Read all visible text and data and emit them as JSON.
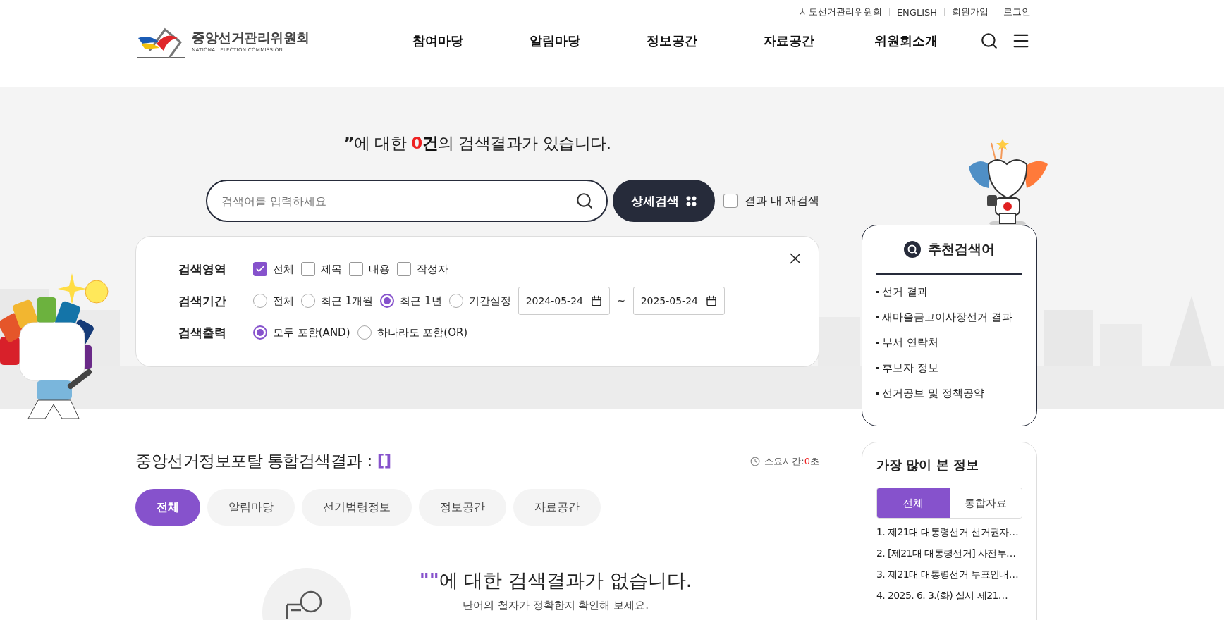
{
  "header": {
    "util_links": [
      "시도선거관리위원회",
      "ENGLISH",
      "회원가입",
      "로그인"
    ],
    "logo": {
      "name": "중앙선거관리위원회",
      "subtitle": "NATIONAL ELECTION COMMISSION"
    },
    "nav": [
      "참여마당",
      "알림마당",
      "정보공간",
      "자료공간",
      "위원회소개"
    ]
  },
  "headline": {
    "quote": "”",
    "pre": "에 대한 ",
    "count": "0",
    "unit": "건",
    "rest": "의 검색결과가 있습니다."
  },
  "search": {
    "placeholder": "검색어를 입력하세요",
    "detail_button": "상세검색",
    "research": {
      "label": "결과 내 재검색",
      "checked": false
    }
  },
  "filters": {
    "rows": [
      {
        "label": "검색영역",
        "kind": "checkbox",
        "options": [
          {
            "label": "전체",
            "selected": true
          },
          {
            "label": "제목",
            "selected": false
          },
          {
            "label": "내용",
            "selected": false
          },
          {
            "label": "작성자",
            "selected": false
          }
        ]
      },
      {
        "label": "검색기간",
        "kind": "radio",
        "options": [
          {
            "label": "전체",
            "selected": false
          },
          {
            "label": "최근 1개월",
            "selected": false
          },
          {
            "label": "최근 1년",
            "selected": true
          },
          {
            "label": "기간설정",
            "selected": false
          }
        ],
        "date_from": "2024-05-24",
        "date_sep": "~",
        "date_to": "2025-05-24"
      },
      {
        "label": "검색출력",
        "kind": "radio",
        "options": [
          {
            "label": "모두 포함(AND)",
            "selected": true
          },
          {
            "label": "하나라도 포함(OR)",
            "selected": false
          }
        ]
      }
    ]
  },
  "results": {
    "title": "중앙선거정보포탈 통합검색결과 : ",
    "query": "[]",
    "time_label": "소요시간:",
    "time_value": "0",
    "time_unit": "초",
    "tabs": [
      {
        "label": "전체",
        "selected": true
      },
      {
        "label": "알림마당",
        "selected": false
      },
      {
        "label": "선거법령정보",
        "selected": false
      },
      {
        "label": "정보공간",
        "selected": false
      },
      {
        "label": "자료공간",
        "selected": false
      }
    ],
    "empty": {
      "quote": "\"\"",
      "message": "에 대한 검색결과가 없습니다.",
      "hint": "단어의 철자가 정확한지 확인해 보세요."
    }
  },
  "recommended": {
    "title": "추천검색어",
    "items": [
      "선거 결과",
      "새마을금고이사장선거 결과",
      "부서 연락처",
      "후보자 정보",
      "선거공보 및 정책공약"
    ]
  },
  "popular": {
    "title": "가장 많이 본 정보",
    "tabs": [
      {
        "label": "전체",
        "selected": true
      },
      {
        "label": "통합자료",
        "selected": false
      }
    ],
    "items": [
      "1. 제21대 대통령선거 선거권자…",
      "2. [제21대 대통령선거] 사전투…",
      "3. 제21대 대통령선거 투표안내…",
      "4. 2025. 6. 3.(화) 실시 제21…"
    ]
  }
}
